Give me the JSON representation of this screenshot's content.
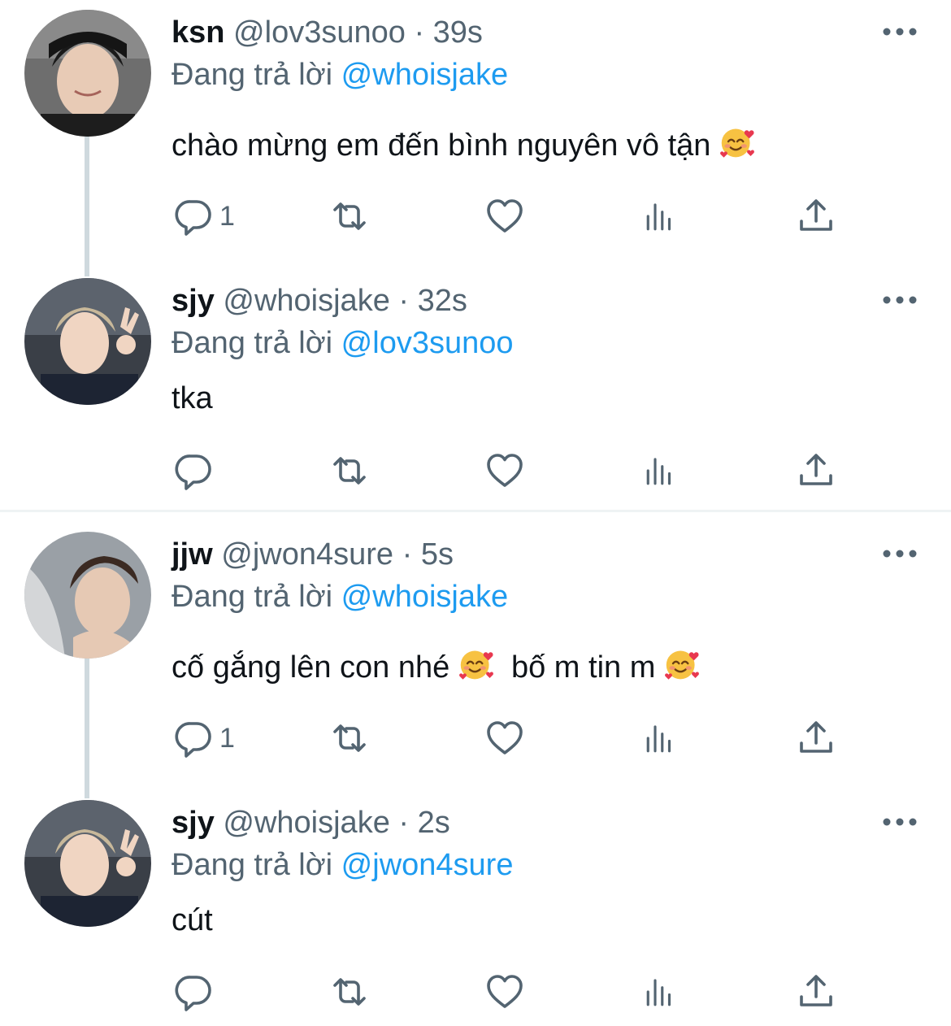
{
  "tweets": [
    {
      "name": "ksn",
      "handle": "@lov3sunoo",
      "sep": "·",
      "time": "39s",
      "reply_prefix": "Đang trả lời",
      "reply_to": "@whoisjake",
      "text": "chào mừng em đến bình nguyên vô tận",
      "text_emoji": "smiling-face-with-hearts",
      "reply_count": "1"
    },
    {
      "name": "sjy",
      "handle": "@whoisjake",
      "sep": "·",
      "time": "32s",
      "reply_prefix": "Đang trả lời",
      "reply_to": "@lov3sunoo",
      "text": "tka",
      "reply_count": ""
    },
    {
      "name": "jjw",
      "handle": "@jwon4sure",
      "sep": "·",
      "time": "5s",
      "reply_prefix": "Đang trả lời",
      "reply_to": "@whoisjake",
      "text_part1": "cố gắng lên con nhé",
      "text_part2": "bố m tin m",
      "text_emoji": "smiling-face-with-hearts",
      "reply_count": "1"
    },
    {
      "name": "sjy",
      "handle": "@whoisjake",
      "sep": "·",
      "time": "2s",
      "reply_prefix": "Đang trả lời",
      "reply_to": "@jwon4sure",
      "text": "cút",
      "reply_count": ""
    }
  ],
  "icons": {
    "reply": "reply-icon",
    "retweet": "retweet-icon",
    "like": "heart-icon",
    "views": "views-icon",
    "share": "share-icon",
    "more": "more-icon"
  },
  "colors": {
    "text": "#0f1419",
    "secondary": "#536471",
    "mention": "#1d9bf0",
    "thread_line": "#cfd9de",
    "divider": "#eff3f4"
  }
}
